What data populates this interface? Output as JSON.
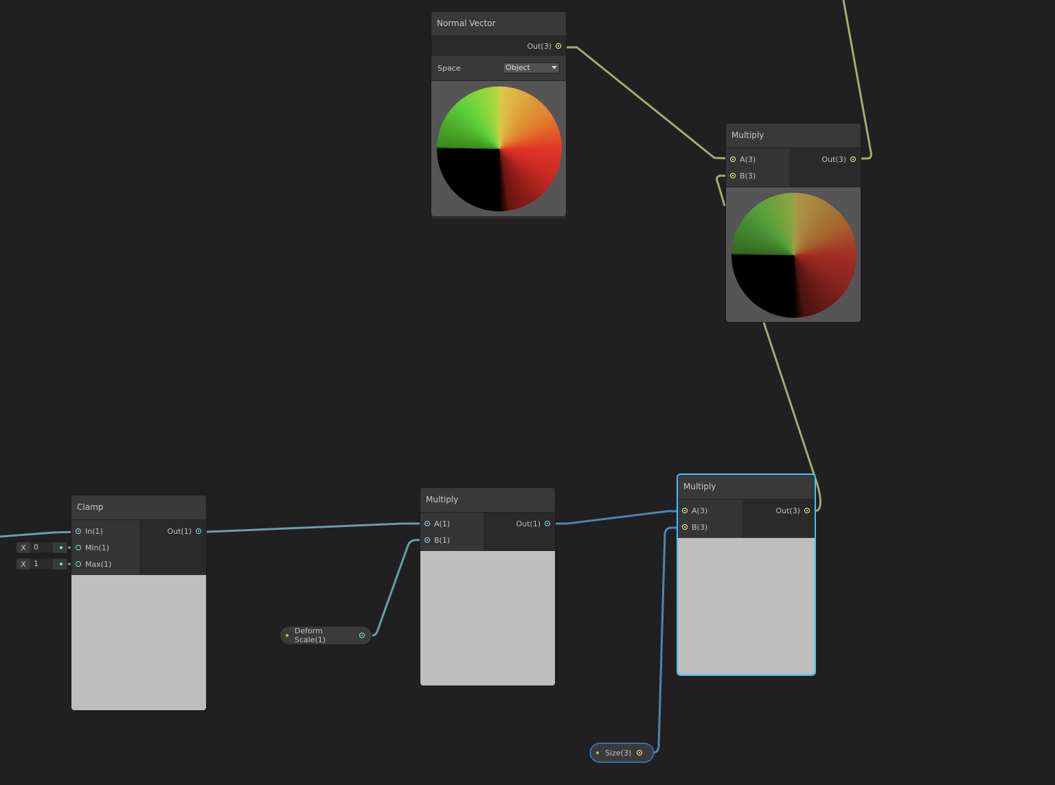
{
  "nodes": {
    "normal_vector": {
      "title": "Normal Vector",
      "output": "Out(3)",
      "space_label": "Space",
      "space_value": "Object"
    },
    "multiply_top": {
      "title": "Multiply",
      "inputs": [
        "A(3)",
        "B(3)"
      ],
      "output": "Out(3)"
    },
    "clamp": {
      "title": "Clamp",
      "inputs": [
        "In(1)",
        "Min(1)",
        "Max(1)"
      ],
      "output": "Out(1)",
      "min_field": {
        "axis": "X",
        "value": "0"
      },
      "max_field": {
        "axis": "X",
        "value": "1"
      }
    },
    "multiply_mid": {
      "title": "Multiply",
      "inputs": [
        "A(1)",
        "B(1)"
      ],
      "output": "Out(1)"
    },
    "multiply_right": {
      "title": "Multiply",
      "inputs": [
        "A(3)",
        "B(3)"
      ],
      "output": "Out(3)"
    }
  },
  "properties": {
    "deform_scale": "Deform Scale(1)",
    "size": "Size(3)"
  },
  "colors": {
    "vector3_wire": "#a4ad6e",
    "vector1_wire": "#6b9ea8",
    "selected_wire": "#4a86b8",
    "selection_outline": "#44c0ff"
  }
}
